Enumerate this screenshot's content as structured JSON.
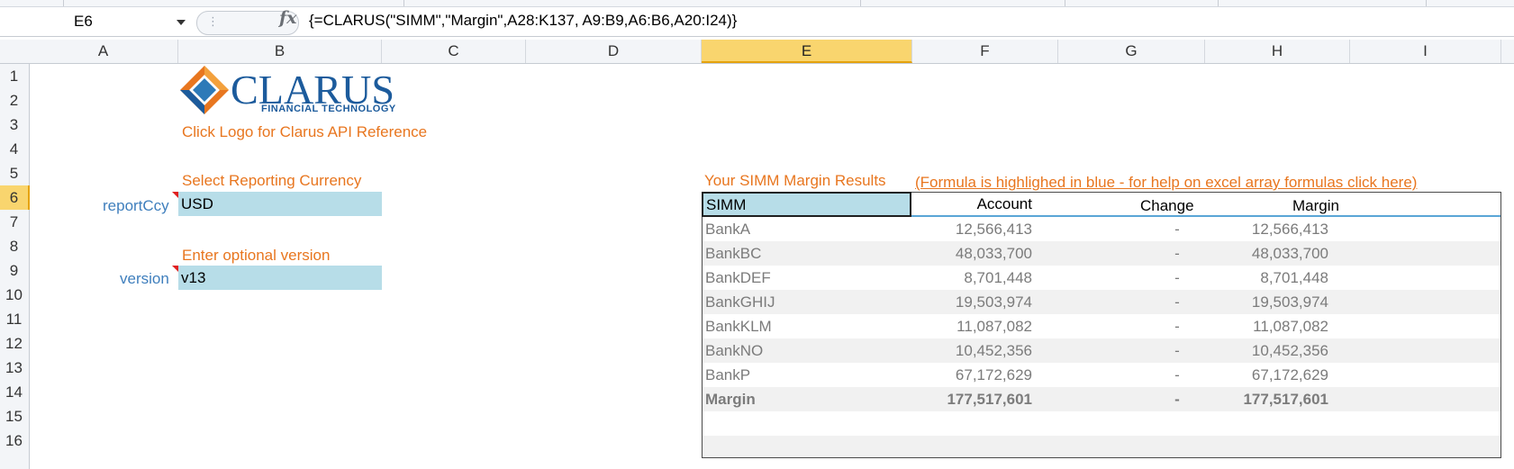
{
  "formula_bar": {
    "name_box": "E6",
    "formula": "{=CLARUS(\"SIMM\",\"Margin\",A28:K137, A9:B9,A6:B6,A20:I24)}",
    "fx_label": "fx"
  },
  "columns": [
    "A",
    "B",
    "C",
    "D",
    "E",
    "F",
    "G",
    "H",
    "I"
  ],
  "selected_column": "E",
  "rows": [
    "1",
    "2",
    "3",
    "4",
    "5",
    "6",
    "7",
    "8",
    "9",
    "10",
    "11",
    "12",
    "13",
    "14",
    "15",
    "16"
  ],
  "selected_row": "6",
  "logo": {
    "brand": "CLARUS",
    "tagline": "FINANCIAL TECHNOLOGY"
  },
  "inputs": {
    "logo_hint": "Click Logo for Clarus API Reference",
    "currency_prompt": "Select Reporting Currency",
    "currency_label": "reportCcy",
    "currency_value": "USD",
    "version_prompt": "Enter optional version",
    "version_label": "version",
    "version_value": "v13"
  },
  "results": {
    "title": "Your SIMM Margin Results",
    "help_link": "(Formula is highlighed in blue - for help on excel array formulas click here)",
    "headers": {
      "name": "SIMM",
      "account": "Account",
      "change": "Change",
      "margin": "Margin"
    },
    "rows": [
      {
        "name": "BankA",
        "account": "12,566,413",
        "change": "-",
        "margin": "12,566,413"
      },
      {
        "name": "BankBC",
        "account": "48,033,700",
        "change": "-",
        "margin": "48,033,700"
      },
      {
        "name": "BankDEF",
        "account": "8,701,448",
        "change": "-",
        "margin": "8,701,448"
      },
      {
        "name": "BankGHIJ",
        "account": "19,503,974",
        "change": "-",
        "margin": "19,503,974"
      },
      {
        "name": "BankKLM",
        "account": "11,087,082",
        "change": "-",
        "margin": "11,087,082"
      },
      {
        "name": "BankNO",
        "account": "10,452,356",
        "change": "-",
        "margin": "10,452,356"
      },
      {
        "name": "BankP",
        "account": "67,172,629",
        "change": "-",
        "margin": "67,172,629"
      }
    ],
    "total": {
      "name": "Margin",
      "account": "177,517,601",
      "change": "-",
      "margin": "177,517,601"
    }
  },
  "colors": {
    "accent_orange": "#e8761f",
    "label_blue": "#3f7fbd",
    "input_fill": "#b7dde8",
    "selection_header": "#f9d56e",
    "logo_navy": "#1c5b9c"
  }
}
